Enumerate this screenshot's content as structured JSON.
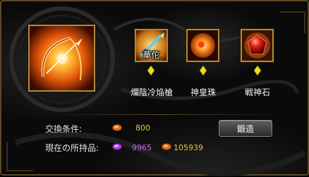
{
  "materials": [
    {
      "name": "爛陰冷焔槍",
      "overlay": "華佗",
      "icon": "spear-icon"
    },
    {
      "name": "神皇珠",
      "icon": "fire-orb-icon"
    },
    {
      "name": "戦神石",
      "icon": "red-gem-icon"
    }
  ],
  "result_item": {
    "icon": "flaming-bow-icon"
  },
  "exchange": {
    "condition_label": "交換条件:",
    "cost": "800",
    "holdings_label": "現在の所持品:",
    "purple_amount": "9965",
    "orange_amount": "105939"
  },
  "forge_button": {
    "label": "鍛造"
  },
  "colors": {
    "frame_gold": "#b08a3c",
    "cost_text": "#f0c24a",
    "purple_text": "#c86bff"
  }
}
